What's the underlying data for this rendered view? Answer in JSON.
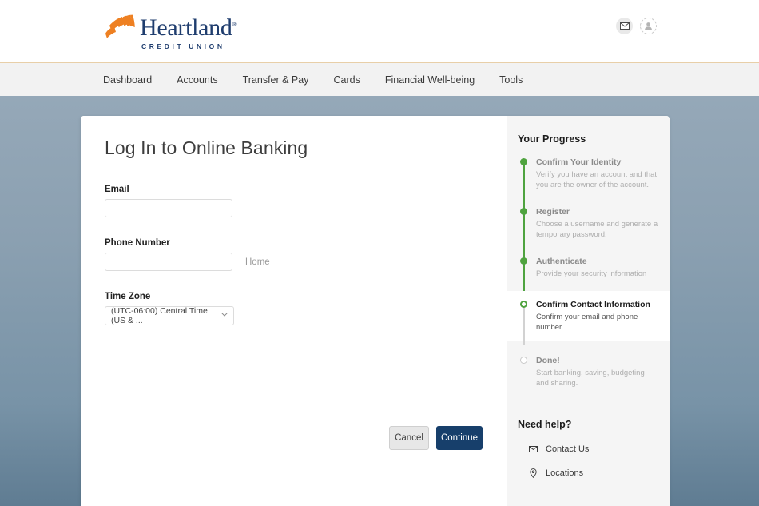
{
  "brand": {
    "name": "Heartland",
    "tagline": "CREDIT UNION",
    "trademark": "®",
    "logo_color": "#ee8022",
    "text_color": "#1f3d6e"
  },
  "header": {
    "mail_icon": "mail-icon",
    "avatar_icon": "user-avatar-icon"
  },
  "nav": {
    "items": [
      {
        "label": "Dashboard"
      },
      {
        "label": "Accounts"
      },
      {
        "label": "Transfer & Pay"
      },
      {
        "label": "Cards"
      },
      {
        "label": "Financial Well-being"
      },
      {
        "label": "Tools"
      }
    ]
  },
  "form": {
    "title": "Log In to Online Banking",
    "email": {
      "label": "Email",
      "value": "",
      "placeholder": ""
    },
    "phone": {
      "label": "Phone Number",
      "value": "",
      "placeholder": "",
      "type_label": "Home"
    },
    "timezone": {
      "label": "Time Zone",
      "value": "(UTC-06:00) Central Time (US & ...",
      "chevron_icon": "chevron-down-icon"
    },
    "buttons": {
      "cancel": "Cancel",
      "continue": "Continue"
    }
  },
  "progress": {
    "title": "Your Progress",
    "accent_color": "#4fa33f",
    "steps": [
      {
        "title": "Confirm Your Identity",
        "desc": "Verify you have an account and that you are the owner of the account.",
        "state": "done"
      },
      {
        "title": "Register",
        "desc": "Choose a username and generate a temporary password.",
        "state": "done"
      },
      {
        "title": "Authenticate",
        "desc": "Provide your security information",
        "state": "done"
      },
      {
        "title": "Confirm Contact Information",
        "desc": "Confirm your email and phone number.",
        "state": "current"
      },
      {
        "title": "Done!",
        "desc": "Start banking, saving, budgeting and sharing.",
        "state": "todo"
      }
    ]
  },
  "help": {
    "title": "Need help?",
    "items": [
      {
        "label": "Contact Us",
        "icon": "envelope-icon"
      },
      {
        "label": "Locations",
        "icon": "map-pin-icon"
      }
    ]
  }
}
